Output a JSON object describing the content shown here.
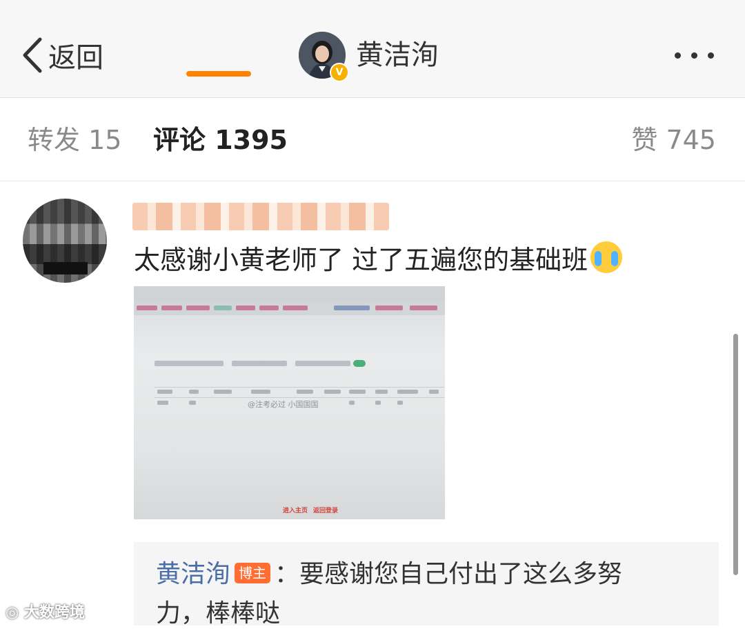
{
  "header": {
    "back_label": "返回",
    "title": "黄洁洵",
    "verified_badge": "V",
    "more_icon": "more-dots-icon"
  },
  "tabs": {
    "forward": "转发 15",
    "comments": "评论 1395",
    "likes": "赞 745",
    "active_color": "#ff8200"
  },
  "comment": {
    "text": "太感谢小黄老师了  过了五遍您的基础班",
    "emoji": "crying-face-emoji",
    "photo": {
      "watermark": "@注考必过 小国国国",
      "links": [
        "进入主页",
        "返回登录"
      ]
    }
  },
  "reply": {
    "author": "黄洁洵",
    "badge": "博主",
    "text_line1": "：要感谢您自己付出了这么多努",
    "text_line2": "力，棒棒哒"
  },
  "watermark": "大数跨境"
}
